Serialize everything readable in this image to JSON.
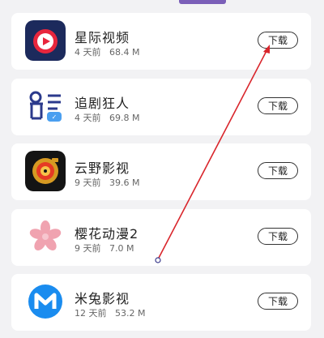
{
  "apps": [
    {
      "name": "星际视频",
      "age": "4 天前",
      "size": "68.4 M",
      "download_label": "下载",
      "icon": "play-circle-icon"
    },
    {
      "name": "追剧狂人",
      "age": "4 天前",
      "size": "69.8 M",
      "download_label": "下载",
      "icon": "chase-drama-logo-icon"
    },
    {
      "name": "云野影视",
      "age": "9 天前",
      "size": "39.6 M",
      "download_label": "下载",
      "icon": "film-reel-icon"
    },
    {
      "name": "樱花动漫2",
      "age": "9 天前",
      "size": "7.0 M",
      "download_label": "下载",
      "icon": "sakura-flower-icon"
    },
    {
      "name": "米兔影视",
      "age": "12 天前",
      "size": "53.2 M",
      "download_label": "下载",
      "icon": "m-logo-icon"
    }
  ],
  "colors": {
    "accent_bar": "#7b5fb8",
    "annotation_arrow": "#d9262c"
  }
}
